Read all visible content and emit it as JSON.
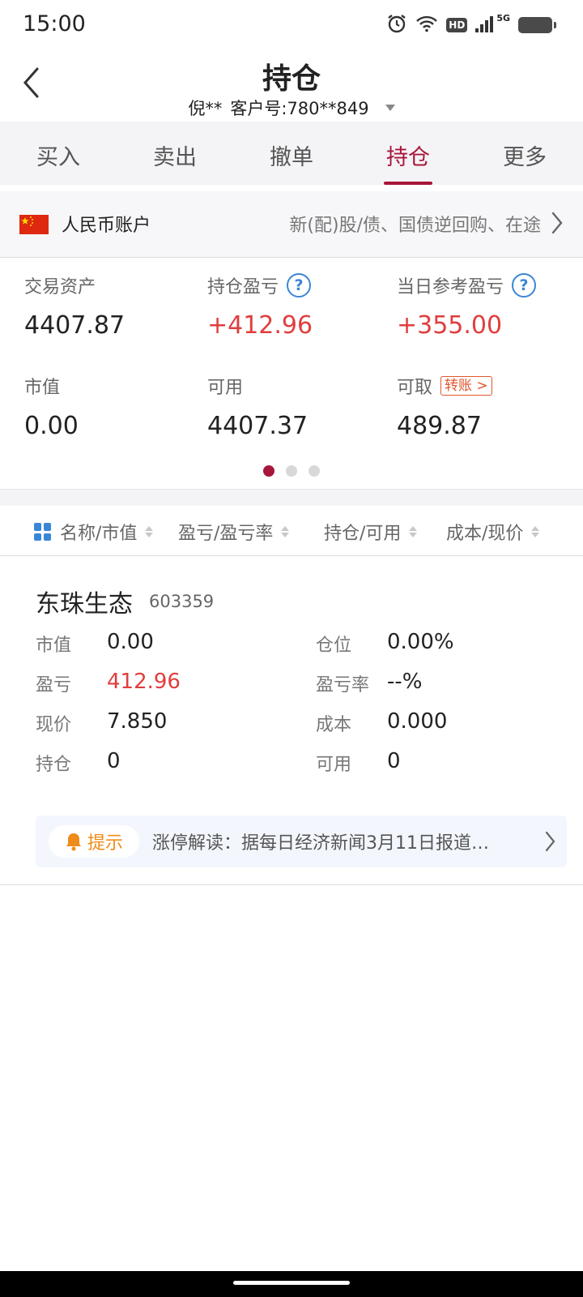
{
  "status_bar": {
    "time": "15:00",
    "hd": "HD",
    "network": "5G"
  },
  "header": {
    "title": "持仓",
    "user_name": "倪**",
    "client_no": "客户号:780**849"
  },
  "tabs": [
    {
      "label": "买入"
    },
    {
      "label": "卖出"
    },
    {
      "label": "撤单"
    },
    {
      "label": "持仓",
      "active": true
    },
    {
      "label": "更多"
    }
  ],
  "account": {
    "name": "人民币账户",
    "desc": "新(配)股/债、国债逆回购、在途"
  },
  "summary": {
    "trade_assets_label": "交易资产",
    "trade_assets": "4407.87",
    "pos_pnl_label": "持仓盈亏",
    "pos_pnl": "+412.96",
    "daily_pnl_label": "当日参考盈亏",
    "daily_pnl": "+355.00",
    "market_value_label": "市值",
    "market_value": "0.00",
    "available_label": "可用",
    "available": "4407.37",
    "withdrawable_label": "可取",
    "transfer_label": "转账 >",
    "withdrawable": "489.87",
    "help_symbol": "?",
    "page_count": 3,
    "active_page": 1
  },
  "columns": {
    "name_mv": "名称/市值",
    "pnl_rate": "盈亏/盈亏率",
    "hold_avail": "持仓/可用",
    "cost_price": "成本/现价"
  },
  "position": {
    "name": "东珠生态",
    "code": "603359",
    "mv_label": "市值",
    "mv": "0.00",
    "weight_label": "仓位",
    "weight": "0.00%",
    "pnl_label": "盈亏",
    "pnl": "412.96",
    "pnl_rate_label": "盈亏率",
    "pnl_rate": "--%",
    "price_label": "现价",
    "price": "7.850",
    "cost_label": "成本",
    "cost": "0.000",
    "hold_label": "持仓",
    "hold": "0",
    "avail_label": "可用",
    "avail": "0",
    "tip_label": "提示",
    "tip_text": "涨停解读：据每日经济新闻3月11日报道…"
  },
  "colors": {
    "accent": "#a8163a",
    "gain": "#e03e3e",
    "link": "#3a86d6",
    "tip": "#ef8b18"
  }
}
